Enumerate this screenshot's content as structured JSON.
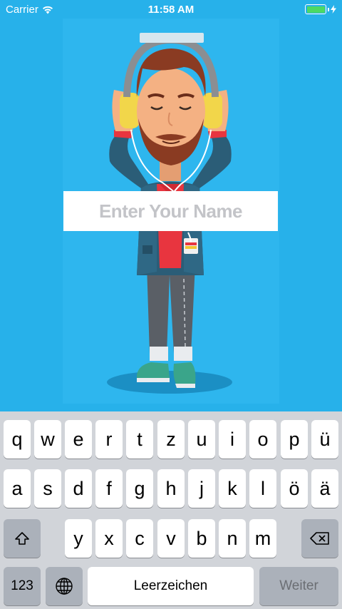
{
  "status_bar": {
    "carrier": "Carrier",
    "time": "11:58 AM",
    "wifi_icon": "wifi-icon",
    "battery_icon": "battery-icon",
    "battery_level": 1.0,
    "charging_icon": "charging-bolt-icon"
  },
  "illustration": {
    "icon": "man-with-headphones-illustration"
  },
  "name_field": {
    "placeholder": "Enter Your Name",
    "value": ""
  },
  "keyboard": {
    "row1": [
      "q",
      "w",
      "e",
      "r",
      "t",
      "z",
      "u",
      "i",
      "o",
      "p",
      "ü"
    ],
    "row2": [
      "a",
      "s",
      "d",
      "f",
      "g",
      "h",
      "j",
      "k",
      "l",
      "ö",
      "ä"
    ],
    "row3": [
      "y",
      "x",
      "c",
      "v",
      "b",
      "n",
      "m"
    ],
    "shift_icon": "shift-icon",
    "backspace_icon": "backspace-icon",
    "numbers_label": "123",
    "globe_icon": "globe-icon",
    "space_label": "Leerzeichen",
    "return_label": "Weiter"
  },
  "colors": {
    "background": "#27b1ea",
    "keyboard_bg": "#d1d4d9",
    "key_light": "#ffffff",
    "key_dark": "#abb1ba",
    "battery_fill": "#4cd964"
  }
}
